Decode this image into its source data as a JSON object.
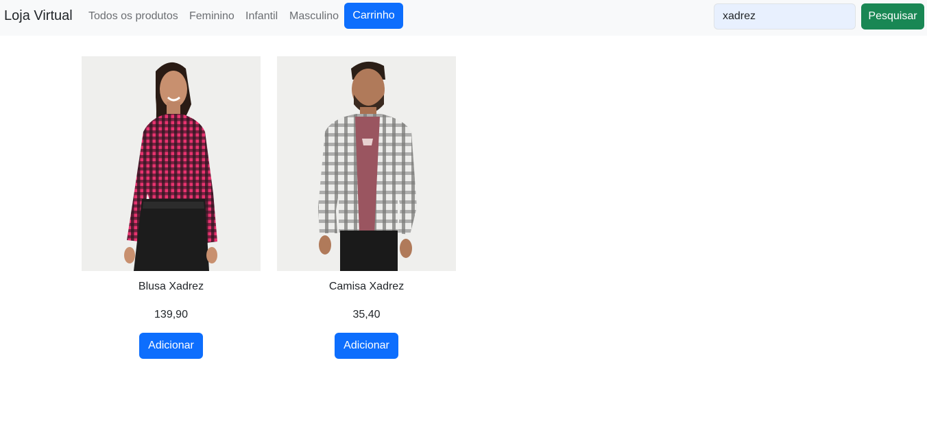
{
  "navbar": {
    "brand": "Loja Virtual",
    "links": [
      {
        "label": "Todos os produtos"
      },
      {
        "label": "Feminino"
      },
      {
        "label": "Infantil"
      },
      {
        "label": "Masculino"
      }
    ],
    "cart_label": "Carrinho",
    "search": {
      "value": "xadrez",
      "button_label": "Pesquisar"
    }
  },
  "products": [
    {
      "name": "Blusa Xadrez",
      "price": "139,90",
      "button_label": "Adicionar",
      "image": "woman-pink-plaid-shirt"
    },
    {
      "name": "Camisa Xadrez",
      "price": "35,40",
      "button_label": "Adicionar",
      "image": "man-gray-plaid-shirt"
    }
  ],
  "colors": {
    "primary": "#0d6efd",
    "success": "#198754",
    "navbar_bg": "#f8f9fa"
  }
}
